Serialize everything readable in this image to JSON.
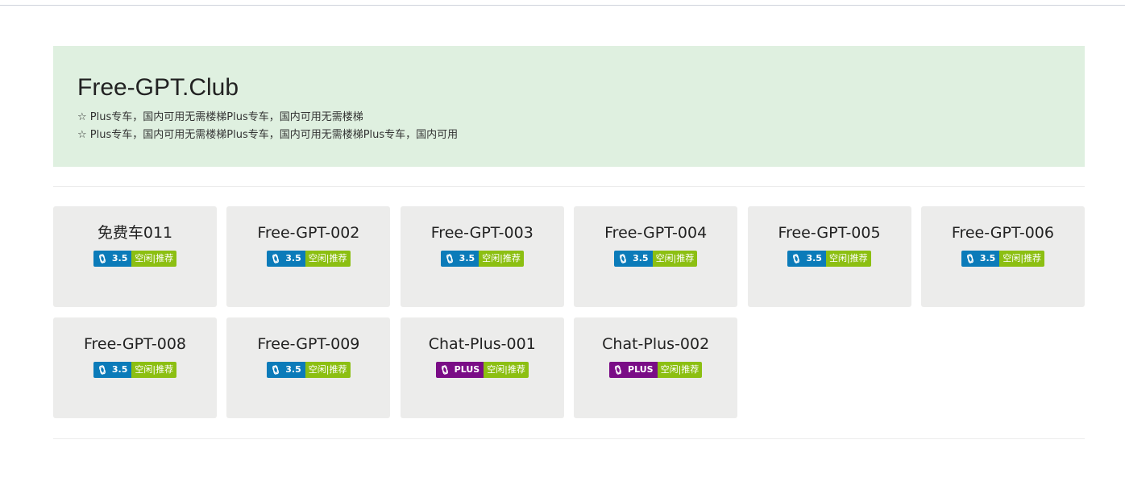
{
  "banner": {
    "title": "Free-GPT.Club",
    "lines": [
      "☆ Plus专车，国内可用无需楼梯Plus专车，国内可用无需楼梯",
      "☆ Plus专车，国内可用无需楼梯Plus专车，国内可用无需楼梯Plus专车，国内可用"
    ]
  },
  "cards": [
    {
      "title": "免费车011",
      "model": "3.5",
      "status": "空闲|推荐",
      "model_color": "#0b7bb9"
    },
    {
      "title": "Free-GPT-002",
      "model": "3.5",
      "status": "空闲|推荐",
      "model_color": "#0b7bb9"
    },
    {
      "title": "Free-GPT-003",
      "model": "3.5",
      "status": "空闲|推荐",
      "model_color": "#0b7bb9"
    },
    {
      "title": "Free-GPT-004",
      "model": "3.5",
      "status": "空闲|推荐",
      "model_color": "#0b7bb9"
    },
    {
      "title": "Free-GPT-005",
      "model": "3.5",
      "status": "空闲|推荐",
      "model_color": "#0b7bb9"
    },
    {
      "title": "Free-GPT-006",
      "model": "3.5",
      "status": "空闲|推荐",
      "model_color": "#0b7bb9"
    },
    {
      "title": "Free-GPT-008",
      "model": "3.5",
      "status": "空闲|推荐",
      "model_color": "#0b7bb9"
    },
    {
      "title": "Free-GPT-009",
      "model": "3.5",
      "status": "空闲|推荐",
      "model_color": "#0b7bb9"
    },
    {
      "title": "Chat-Plus-001",
      "model": "PLUS",
      "status": "空闲|推荐",
      "model_color": "#7a0c86"
    },
    {
      "title": "Chat-Plus-002",
      "model": "PLUS",
      "status": "空闲|推荐",
      "model_color": "#7a0c86"
    }
  ],
  "colors": {
    "banner_bg": "#dff0e0",
    "card_bg": "#ececeb",
    "badge_35": "#0b7bb9",
    "badge_plus": "#7a0c86",
    "badge_status": "#8cbf12"
  },
  "icons": {
    "badge_icon": "openai-knot-icon"
  }
}
